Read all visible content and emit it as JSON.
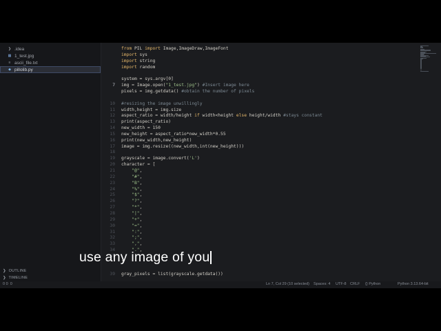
{
  "sidebar": {
    "items": [
      {
        "icon": "chevron-right-icon",
        "label": ".idea",
        "selected": false
      },
      {
        "icon": "image-file-icon",
        "label": "1_test.jpg",
        "selected": false
      },
      {
        "icon": "text-file-icon",
        "label": "ascii_file.txt",
        "selected": false
      },
      {
        "icon": "python-file-icon",
        "label": "pillolib.py",
        "selected": true
      }
    ],
    "outline_label": "OUTLINE",
    "timeline_label": "TIMELINE"
  },
  "editor": {
    "current_line": 7,
    "lines": [
      {
        "n": "",
        "text": "from PIL import Image,ImageDraw,ImageFont"
      },
      {
        "n": "",
        "text": "import sys"
      },
      {
        "n": "",
        "text": "import string"
      },
      {
        "n": "",
        "text": "import random"
      },
      {
        "n": "",
        "text": ""
      },
      {
        "n": "",
        "text": "system = sys.argv[0]"
      },
      {
        "n": "7",
        "text": "img = Image.open(\"1_test.jpg\") #Insert image here"
      },
      {
        "n": "",
        "text": "pixels = img.getdata() #obtain the number of pixels"
      },
      {
        "n": "",
        "text": ""
      },
      {
        "n": "10",
        "text": "#resizing the image unwillingly"
      },
      {
        "n": "11",
        "text": "width,height = img.size"
      },
      {
        "n": "12",
        "text": "aspect_ratio = width/height if width<height else height/width #stays constant"
      },
      {
        "n": "13",
        "text": "print(aspect_ratio)"
      },
      {
        "n": "14",
        "text": "new_width = 150"
      },
      {
        "n": "15",
        "text": "new_height = aspect_ratio*new_width*0.55"
      },
      {
        "n": "16",
        "text": "print(new_width,new_height)"
      },
      {
        "n": "17",
        "text": "image = img.resize((new_width,int(new_height)))"
      },
      {
        "n": "18",
        "text": ""
      },
      {
        "n": "19",
        "text": "grayscale = image.convert('L')"
      },
      {
        "n": "20",
        "text": "character = ["
      },
      {
        "n": "21",
        "text": "    \"@\","
      },
      {
        "n": "22",
        "text": "    \"#\","
      },
      {
        "n": "23",
        "text": "    \"B\","
      },
      {
        "n": "24",
        "text": "    \"%\","
      },
      {
        "n": "25",
        "text": "    \"$\","
      },
      {
        "n": "26",
        "text": "    \"?\","
      },
      {
        "n": "27",
        "text": "    \"*\","
      },
      {
        "n": "28",
        "text": "    \"|\","
      },
      {
        "n": "29",
        "text": "    \"+\","
      },
      {
        "n": "30",
        "text": "    \"=\","
      },
      {
        "n": "31",
        "text": "    \":\","
      },
      {
        "n": "32",
        "text": "    \";\","
      },
      {
        "n": "33",
        "text": "    \",\","
      },
      {
        "n": "34",
        "text": "    \".\","
      },
      {
        "n": "35",
        "text": ""
      },
      {
        "n": "",
        "text": "]"
      },
      {
        "n": "",
        "text": ""
      },
      {
        "n": "39",
        "text": "gray_pixels = list(grayscale.getdata())"
      }
    ]
  },
  "status_bar": {
    "cursor": "Ln 7, Col 29 (10 selected)",
    "spaces": "Spaces: 4",
    "encoding": "UTF-8",
    "eol": "CRLF",
    "language": "{} Python",
    "interpreter": "Python 3.13.64-bit",
    "problems": "0 0  0"
  },
  "caption": "use any image of you"
}
